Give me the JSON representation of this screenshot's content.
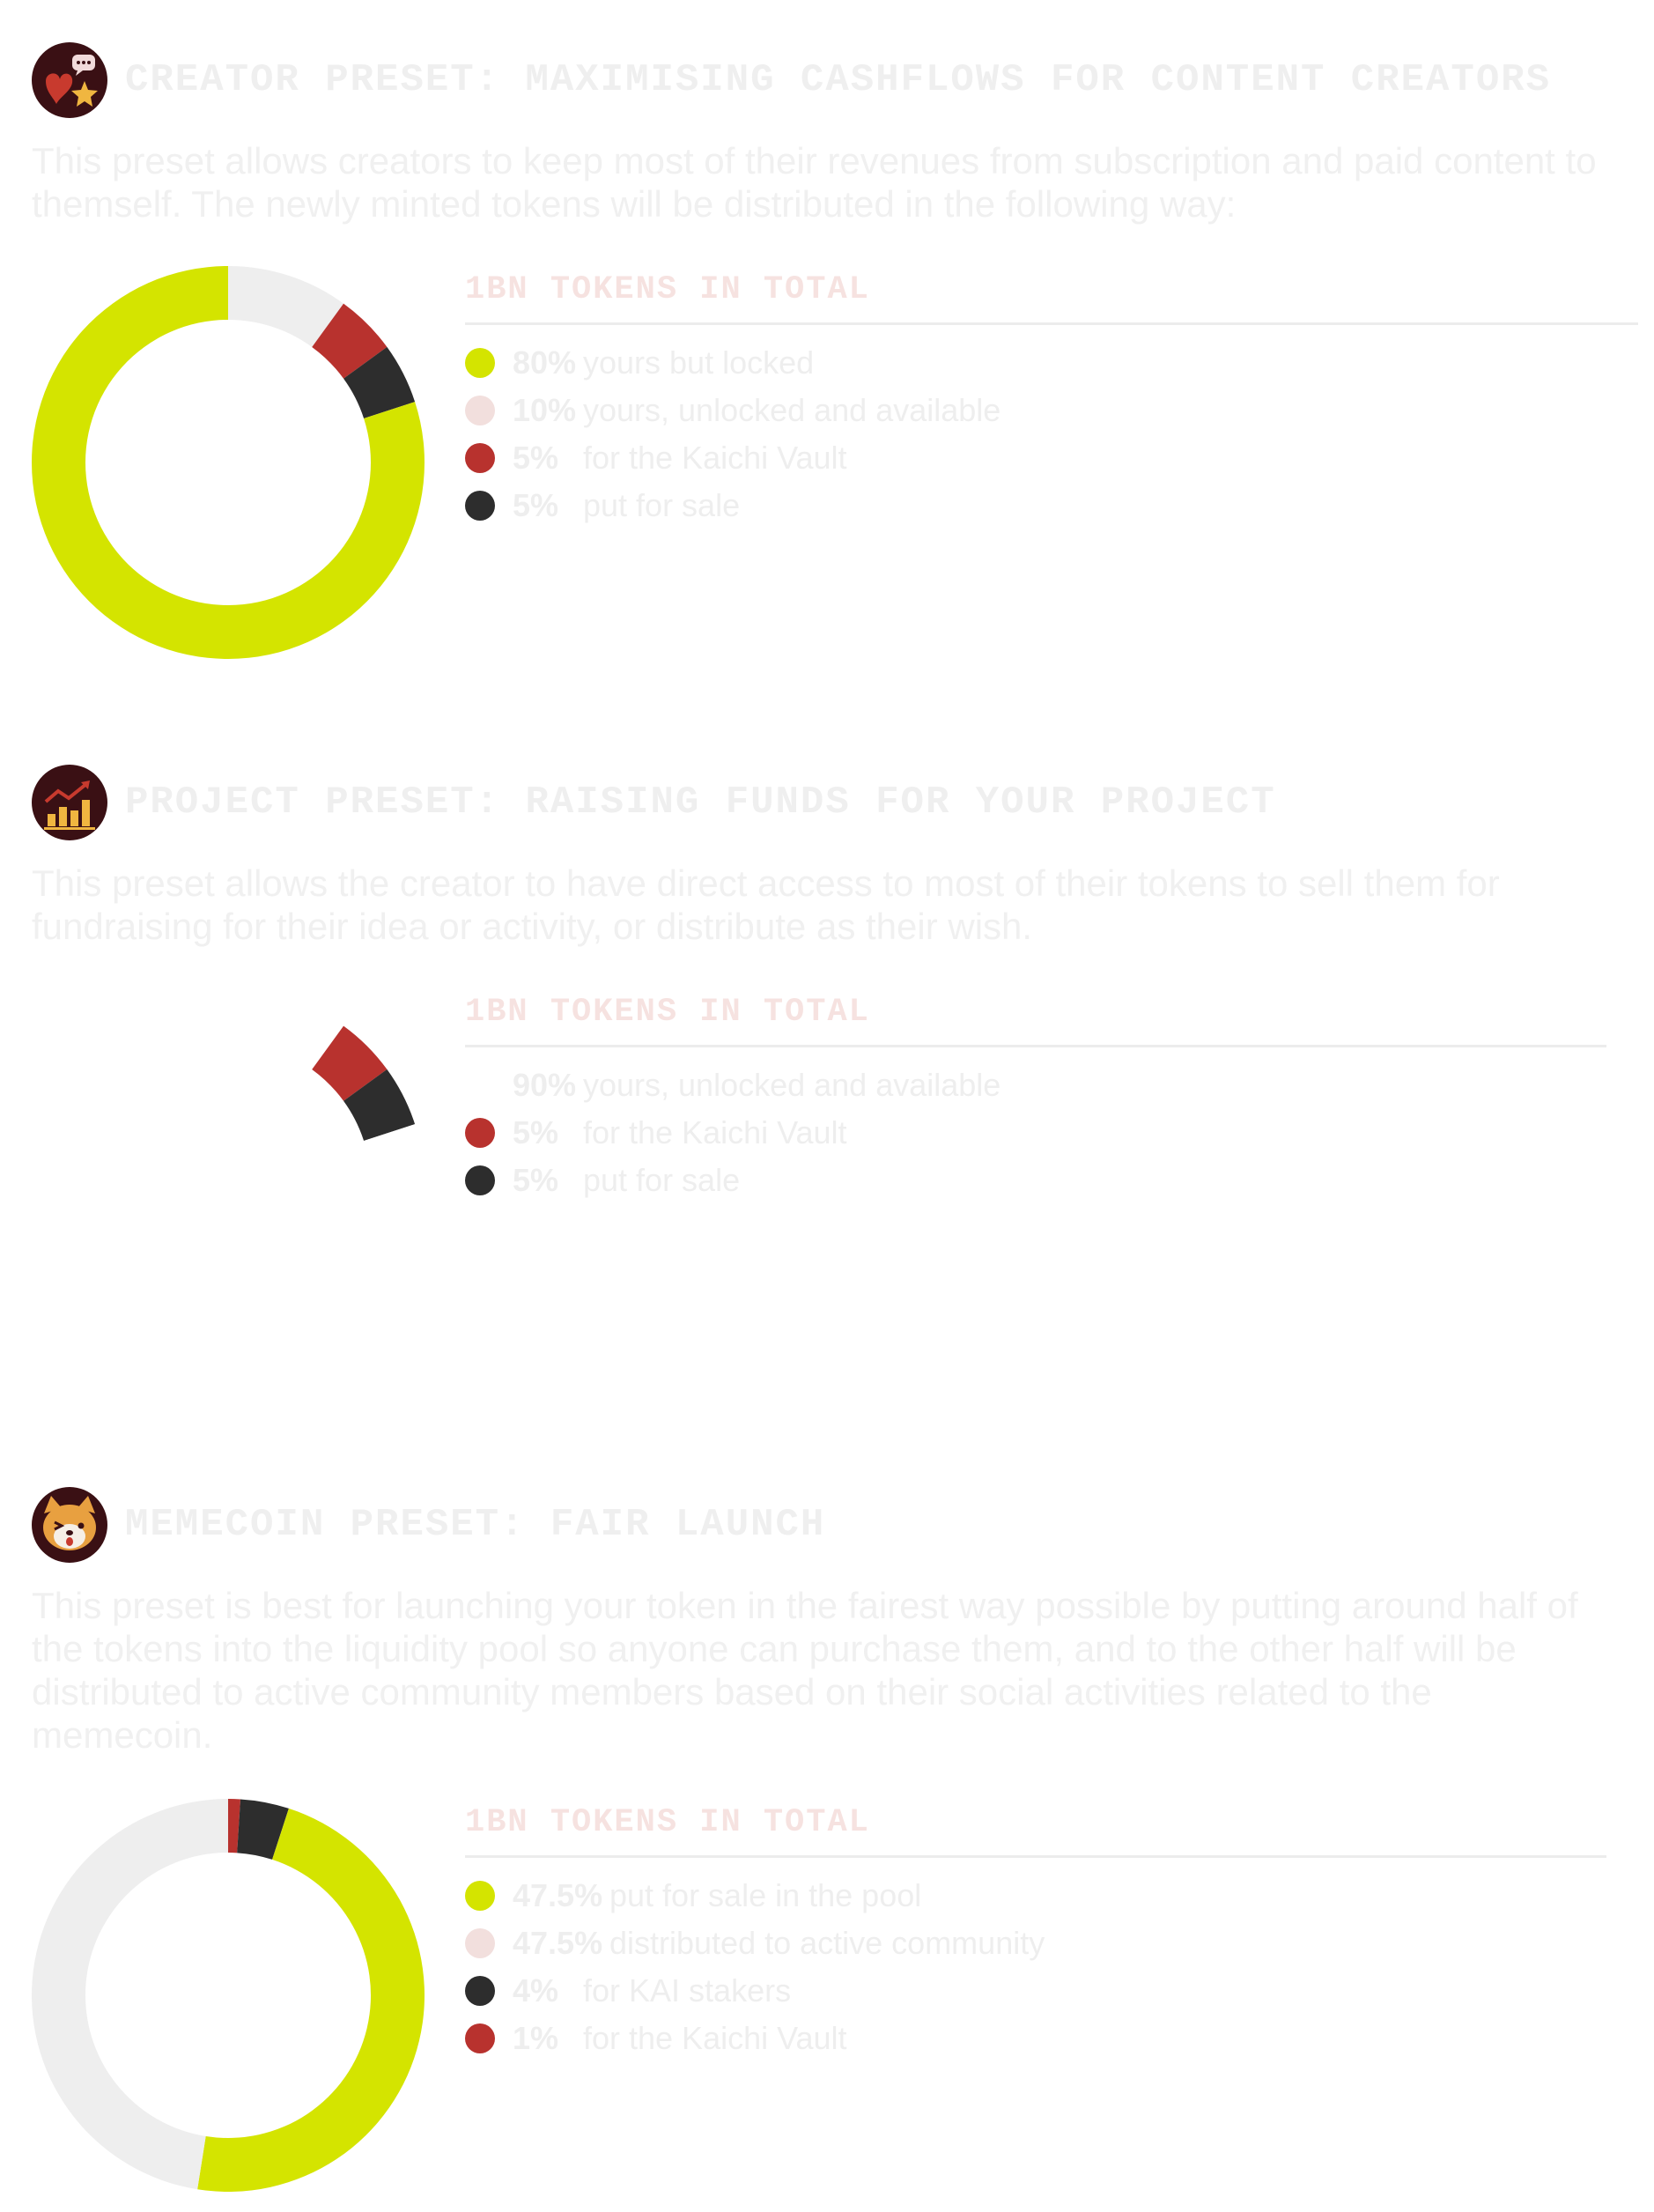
{
  "colors": {
    "green": "#d4e400",
    "pink": "#f2dfdd",
    "gray": "#eeeeee",
    "red": "#b8322e",
    "dark": "#2d2d2d"
  },
  "sections": [
    {
      "icon": "creator-hearts-star-icon",
      "title": "CREATOR PRESET: MAXIMISING CASHFLOWS FOR CONTENT CREATORS",
      "description": "This preset allows creators to keep most of their revenues from subscription and paid content to themself. The newly minted tokens will be distributed in the following way:",
      "total_label": "1BN TOKENS IN TOTAL",
      "legend": [
        {
          "pct": "80%",
          "label": "yours but locked",
          "color": "#d4e400"
        },
        {
          "pct": "10%",
          "label": "yours, unlocked and available",
          "color": "#f2dfdd"
        },
        {
          "pct": "5%",
          "label": "for the Kaichi Vault",
          "color": "#b8322e"
        },
        {
          "pct": "5%",
          "label": "put for sale",
          "color": "#2d2d2d"
        }
      ]
    },
    {
      "icon": "bar-chart-growth-icon",
      "title": "PROJECT PRESET: RAISING FUNDS FOR YOUR PROJECT",
      "description": "This preset allows the creator to have direct access to most of their tokens to sell them for fundraising for their idea or activity, or distribute as their wish.",
      "total_label": "1BN TOKENS IN TOTAL",
      "legend": [
        {
          "pct": "90%",
          "label": "yours, unlocked and available",
          "color": "#ffffff"
        },
        {
          "pct": "5%",
          "label": "for the Kaichi Vault",
          "color": "#b8322e"
        },
        {
          "pct": "5%",
          "label": "put for sale",
          "color": "#2d2d2d"
        }
      ]
    },
    {
      "icon": "shiba-dog-face-icon",
      "title": "MEMECOIN PRESET: FAIR LAUNCH",
      "description": "This preset is best for launching your token in the fairest way possible by putting around half of the tokens into the liquidity pool so anyone can purchase them, and to the other half will be distributed to active community members based on their social activities related to the memecoin.",
      "total_label": "1BN TOKENS IN TOTAL",
      "legend": [
        {
          "pct": "47.5%",
          "label": "put for sale in the pool",
          "color": "#d4e400"
        },
        {
          "pct": "47.5%",
          "label": "distributed to active community",
          "color": "#f2dfdd"
        },
        {
          "pct": "4%",
          "label": "for KAI stakers",
          "color": "#2d2d2d"
        },
        {
          "pct": "1%",
          "label": "for the Kaichi Vault",
          "color": "#b8322e"
        }
      ]
    }
  ],
  "chart_data": [
    {
      "type": "pie",
      "title": "1BN TOKENS IN TOTAL",
      "categories": [
        "yours but locked",
        "yours, unlocked and available",
        "for the Kaichi Vault",
        "put for sale"
      ],
      "values": [
        80,
        10,
        5,
        5
      ],
      "slices": [
        {
          "value": 10,
          "color": "#eeeeee"
        },
        {
          "value": 5,
          "color": "#b8322e"
        },
        {
          "value": 5,
          "color": "#2d2d2d"
        },
        {
          "value": 80,
          "color": "#d4e400"
        }
      ]
    },
    {
      "type": "pie",
      "title": "1BN TOKENS IN TOTAL",
      "categories": [
        "yours, unlocked and available",
        "for the Kaichi Vault",
        "put for sale"
      ],
      "values": [
        90,
        5,
        5
      ],
      "slices": [
        {
          "value": 10,
          "color": "#ffffff"
        },
        {
          "value": 5,
          "color": "#b8322e"
        },
        {
          "value": 5,
          "color": "#2d2d2d"
        },
        {
          "value": 80,
          "color": "#ffffff"
        }
      ]
    },
    {
      "type": "pie",
      "title": "1BN TOKENS IN TOTAL",
      "categories": [
        "put for sale in the pool",
        "distributed to active community",
        "for KAI stakers",
        "for the Kaichi Vault"
      ],
      "values": [
        47.5,
        47.5,
        4,
        1
      ],
      "slices": [
        {
          "value": 1,
          "color": "#b8322e"
        },
        {
          "value": 4,
          "color": "#2d2d2d"
        },
        {
          "value": 47.5,
          "color": "#d4e400"
        },
        {
          "value": 47.5,
          "color": "#eeeeee"
        }
      ]
    }
  ]
}
